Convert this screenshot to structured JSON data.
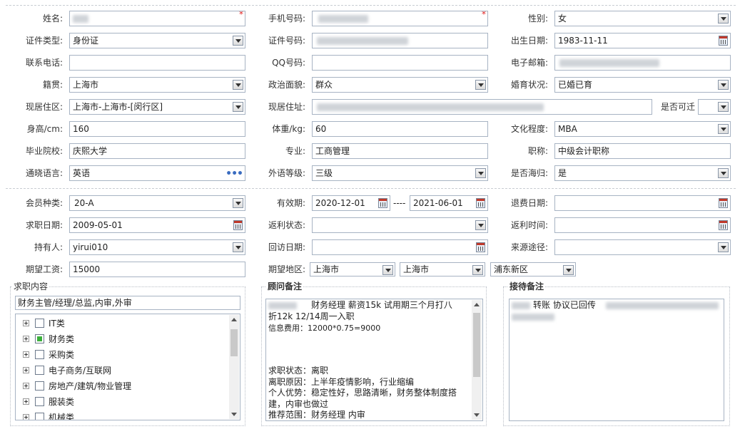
{
  "personal": {
    "name_label": "姓名:",
    "phone_label": "手机号码:",
    "gender_label": "性别:",
    "gender_value": "女",
    "id_type_label": "证件类型:",
    "id_type_value": "身份证",
    "id_no_label": "证件号码:",
    "birth_label": "出生日期:",
    "birth_value": "1983-11-11",
    "contact_phone_label": "联系电话:",
    "qq_label": "QQ号码:",
    "email_label": "电子邮箱:",
    "native_label": "籍贯:",
    "native_value": "上海市",
    "politics_label": "政治面貌:",
    "politics_value": "群众",
    "marital_label": "婚育状况:",
    "marital_value": "已婚已育",
    "residence_area_label": "现居住区:",
    "residence_area_value": "上海市-上海市-[闵行区]",
    "address_label": "现居住址:",
    "relocate_label": "是否可迁",
    "height_label": "身高/cm:",
    "height_value": "160",
    "weight_label": "体重/kg:",
    "weight_value": "60",
    "education_label": "文化程度:",
    "education_value": "MBA",
    "school_label": "毕业院校:",
    "school_value": "庆熙大学",
    "major_label": "专业:",
    "major_value": "工商管理",
    "title_label": "职称:",
    "title_value": "中级会计职称",
    "language_label": "通晓语言:",
    "language_value": "英语",
    "lang_level_label": "外语等级:",
    "lang_level_value": "三级",
    "returnee_label": "是否海归:",
    "returnee_value": "是"
  },
  "member": {
    "type_label": "会员种类:",
    "type_value": "20-A",
    "valid_label": "有效期:",
    "valid_from": "2020-12-01",
    "valid_sep": "----",
    "valid_to": "2021-06-01",
    "refund_date_label": "退费日期:",
    "apply_date_label": "求职日期:",
    "apply_date_value": "2009-05-01",
    "rebate_status_label": "返利状态:",
    "rebate_time_label": "返利时间:",
    "holder_label": "持有人:",
    "holder_value": "yirui010",
    "visit_date_label": "回访日期:",
    "source_label": "来源途径:",
    "salary_label": "期望工资:",
    "salary_value": "15000",
    "region_label": "期望地区:",
    "region_province": "上海市",
    "region_city": "上海市",
    "region_district": "浦东新区"
  },
  "job": {
    "legend": "求职内容",
    "selected_summary": "财务主管/经理/总监,内审,外审",
    "categories": [
      {
        "label": "IT类",
        "checked": false
      },
      {
        "label": "财务类",
        "checked": true
      },
      {
        "label": "采购类",
        "checked": false
      },
      {
        "label": "电子商务/互联网",
        "checked": false
      },
      {
        "label": "房地产/建筑/物业管理",
        "checked": false
      },
      {
        "label": "服装类",
        "checked": false
      },
      {
        "label": "机械类",
        "checked": false
      }
    ]
  },
  "consultant": {
    "legend": "顾问备注",
    "lines": [
      "财务经理   薪资15k 试用期三个月打八",
      "折12k    12/14周一入职",
      "信息费用：12000*0.75=9000",
      "",
      "",
      "",
      "求职状态：离职",
      "离职原因：上半年疫情影响，行业缩编",
      "个人优势：稳定性好，思路清晰，财务整体制度搭",
      "建，内审也做过",
      "推荐范围：财务经理 内审"
    ]
  },
  "reception": {
    "legend": "接待备注",
    "line1": "转账  协议已回传"
  },
  "colors": {
    "border": "#a7b3c3",
    "required": "#e02020",
    "checked_green": "#3bb03b",
    "dots_blue": "#3a6cc0"
  }
}
